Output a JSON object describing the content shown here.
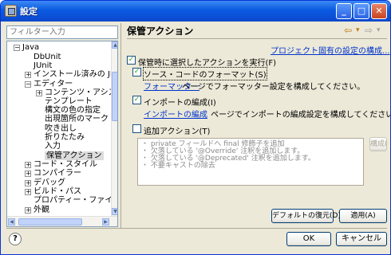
{
  "window": {
    "title": "設定"
  },
  "filter": {
    "placeholder": "フィルター入力"
  },
  "tree": {
    "items": [
      {
        "label": "Java",
        "expander": "−"
      },
      {
        "label": "DbUnit",
        "expander": ""
      },
      {
        "label": "JUnit",
        "expander": ""
      },
      {
        "label": "インストール済みの JRE",
        "expander": "+"
      },
      {
        "label": "エディター",
        "expander": "−"
      },
      {
        "label": "コンテンツ・アシスト",
        "expander": "+"
      },
      {
        "label": "テンプレート",
        "expander": ""
      },
      {
        "label": "構文の色の指定",
        "expander": ""
      },
      {
        "label": "出現箇所のマーク",
        "expander": ""
      },
      {
        "label": "吹き出し",
        "expander": ""
      },
      {
        "label": "折りたたみ",
        "expander": ""
      },
      {
        "label": "入力",
        "expander": ""
      },
      {
        "label": "保管アクション",
        "expander": ""
      },
      {
        "label": "コード・スタイル",
        "expander": "+"
      },
      {
        "label": "コンパイラー",
        "expander": "+"
      },
      {
        "label": "デバッグ",
        "expander": "+"
      },
      {
        "label": "ビルド・パス",
        "expander": "+"
      },
      {
        "label": "プロパティー・ファイル・エディ",
        "expander": ""
      },
      {
        "label": "外観",
        "expander": "+"
      }
    ]
  },
  "page": {
    "title": "保管アクション",
    "nav_back": "⇦",
    "nav_back_dd": "▾",
    "nav_fwd": "⇨",
    "nav_fwd_dd": "▾",
    "project_link": "プロジェクト固有の設定の構成...",
    "perform_on_save": "保管時に選択したアクションを実行(F)",
    "format_source": "ソース・コードのフォーマット(S)",
    "formatter_link": "フォーマッター",
    "formatter_rest": "ページでフォーマッター設定を構成してください。",
    "organize_imports": "インポートの編成(I)",
    "imports_link": "インポートの編成",
    "imports_rest": "ページでインポートの編成設定を構成してください。",
    "additional_actions": "追加アクション(T)",
    "additional_list": [
      "・ private フィールドへ final 修飾子を追加",
      "・ 欠落している '@Override' 注釈を追加します。",
      "・ 欠落している '@Deprecated' 注釈を追加します。",
      "・ 不要キャストの除去"
    ],
    "configure_button": "構成(N)...",
    "restore_defaults": "デフォルトの復元(D)",
    "apply": "適用(A)"
  },
  "footer": {
    "help": "?",
    "ok": "OK",
    "cancel": "キャンセル"
  },
  "checks": {
    "perform_on_save": "✓",
    "format_source": "✓",
    "organize_imports": "✓",
    "additional_actions": ""
  },
  "colors": {
    "accent": "#0a5ae0",
    "link": "#0033cc",
    "check": "#21a121"
  }
}
